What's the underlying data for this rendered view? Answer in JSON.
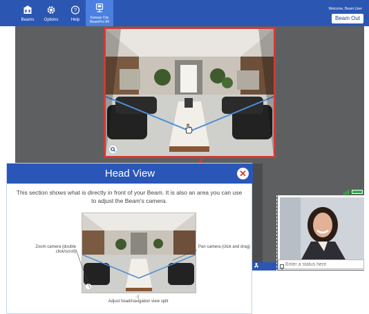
{
  "topbar": {
    "nav": [
      {
        "label": "Beams",
        "icon": "building-icon"
      },
      {
        "label": "Options",
        "icon": "gear-icon"
      },
      {
        "label": "Help",
        "icon": "help-icon"
      },
      {
        "label": "Kansas City BeamPro 84",
        "icon": "beam-device-icon",
        "active": true
      }
    ],
    "welcome": "Welcome, Beam User",
    "beam_out": "Beam Out"
  },
  "video": {
    "status_placeholder": "Enter a status here"
  },
  "callout": {
    "title": "Head View",
    "description": "This section shows what is directly in front of your Beam. It is also an area you can use to adjust the Beam's camera.",
    "zoom_label": "Zoom camera (double click/scroll)",
    "pan_label": "Pan camera (click and drag)",
    "split_label": "Adjust head/navigation view split"
  },
  "colors": {
    "brand_blue": "#2b57b3",
    "highlight_red": "#d23a35",
    "battery_green": "#30b048"
  }
}
